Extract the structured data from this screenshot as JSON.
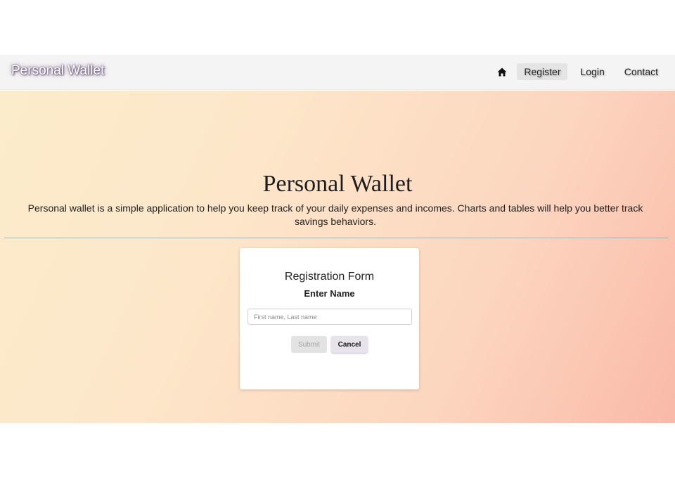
{
  "navbar": {
    "brand": "Personal Wallet",
    "home_icon": "home-icon",
    "links": [
      {
        "label": "Register",
        "active": true
      },
      {
        "label": "Login",
        "active": false
      },
      {
        "label": "Contact",
        "active": false
      }
    ]
  },
  "hero": {
    "title": "Personal Wallet",
    "description": "Personal wallet is a simple application to help you keep track of your daily expenses and incomes. Charts and tables will help you better track savings behaviors."
  },
  "form": {
    "title": "Registration Form",
    "subtitle": "Enter Name",
    "name_input": {
      "value": "",
      "placeholder": "First name, Last name"
    },
    "submit_label": "Submit",
    "cancel_label": "Cancel"
  },
  "colors": {
    "gradient_start": "#fbeccb",
    "gradient_end": "#fab9a8",
    "divider": "#8fbdcf",
    "navbar_bg": "#f4f4f4"
  }
}
